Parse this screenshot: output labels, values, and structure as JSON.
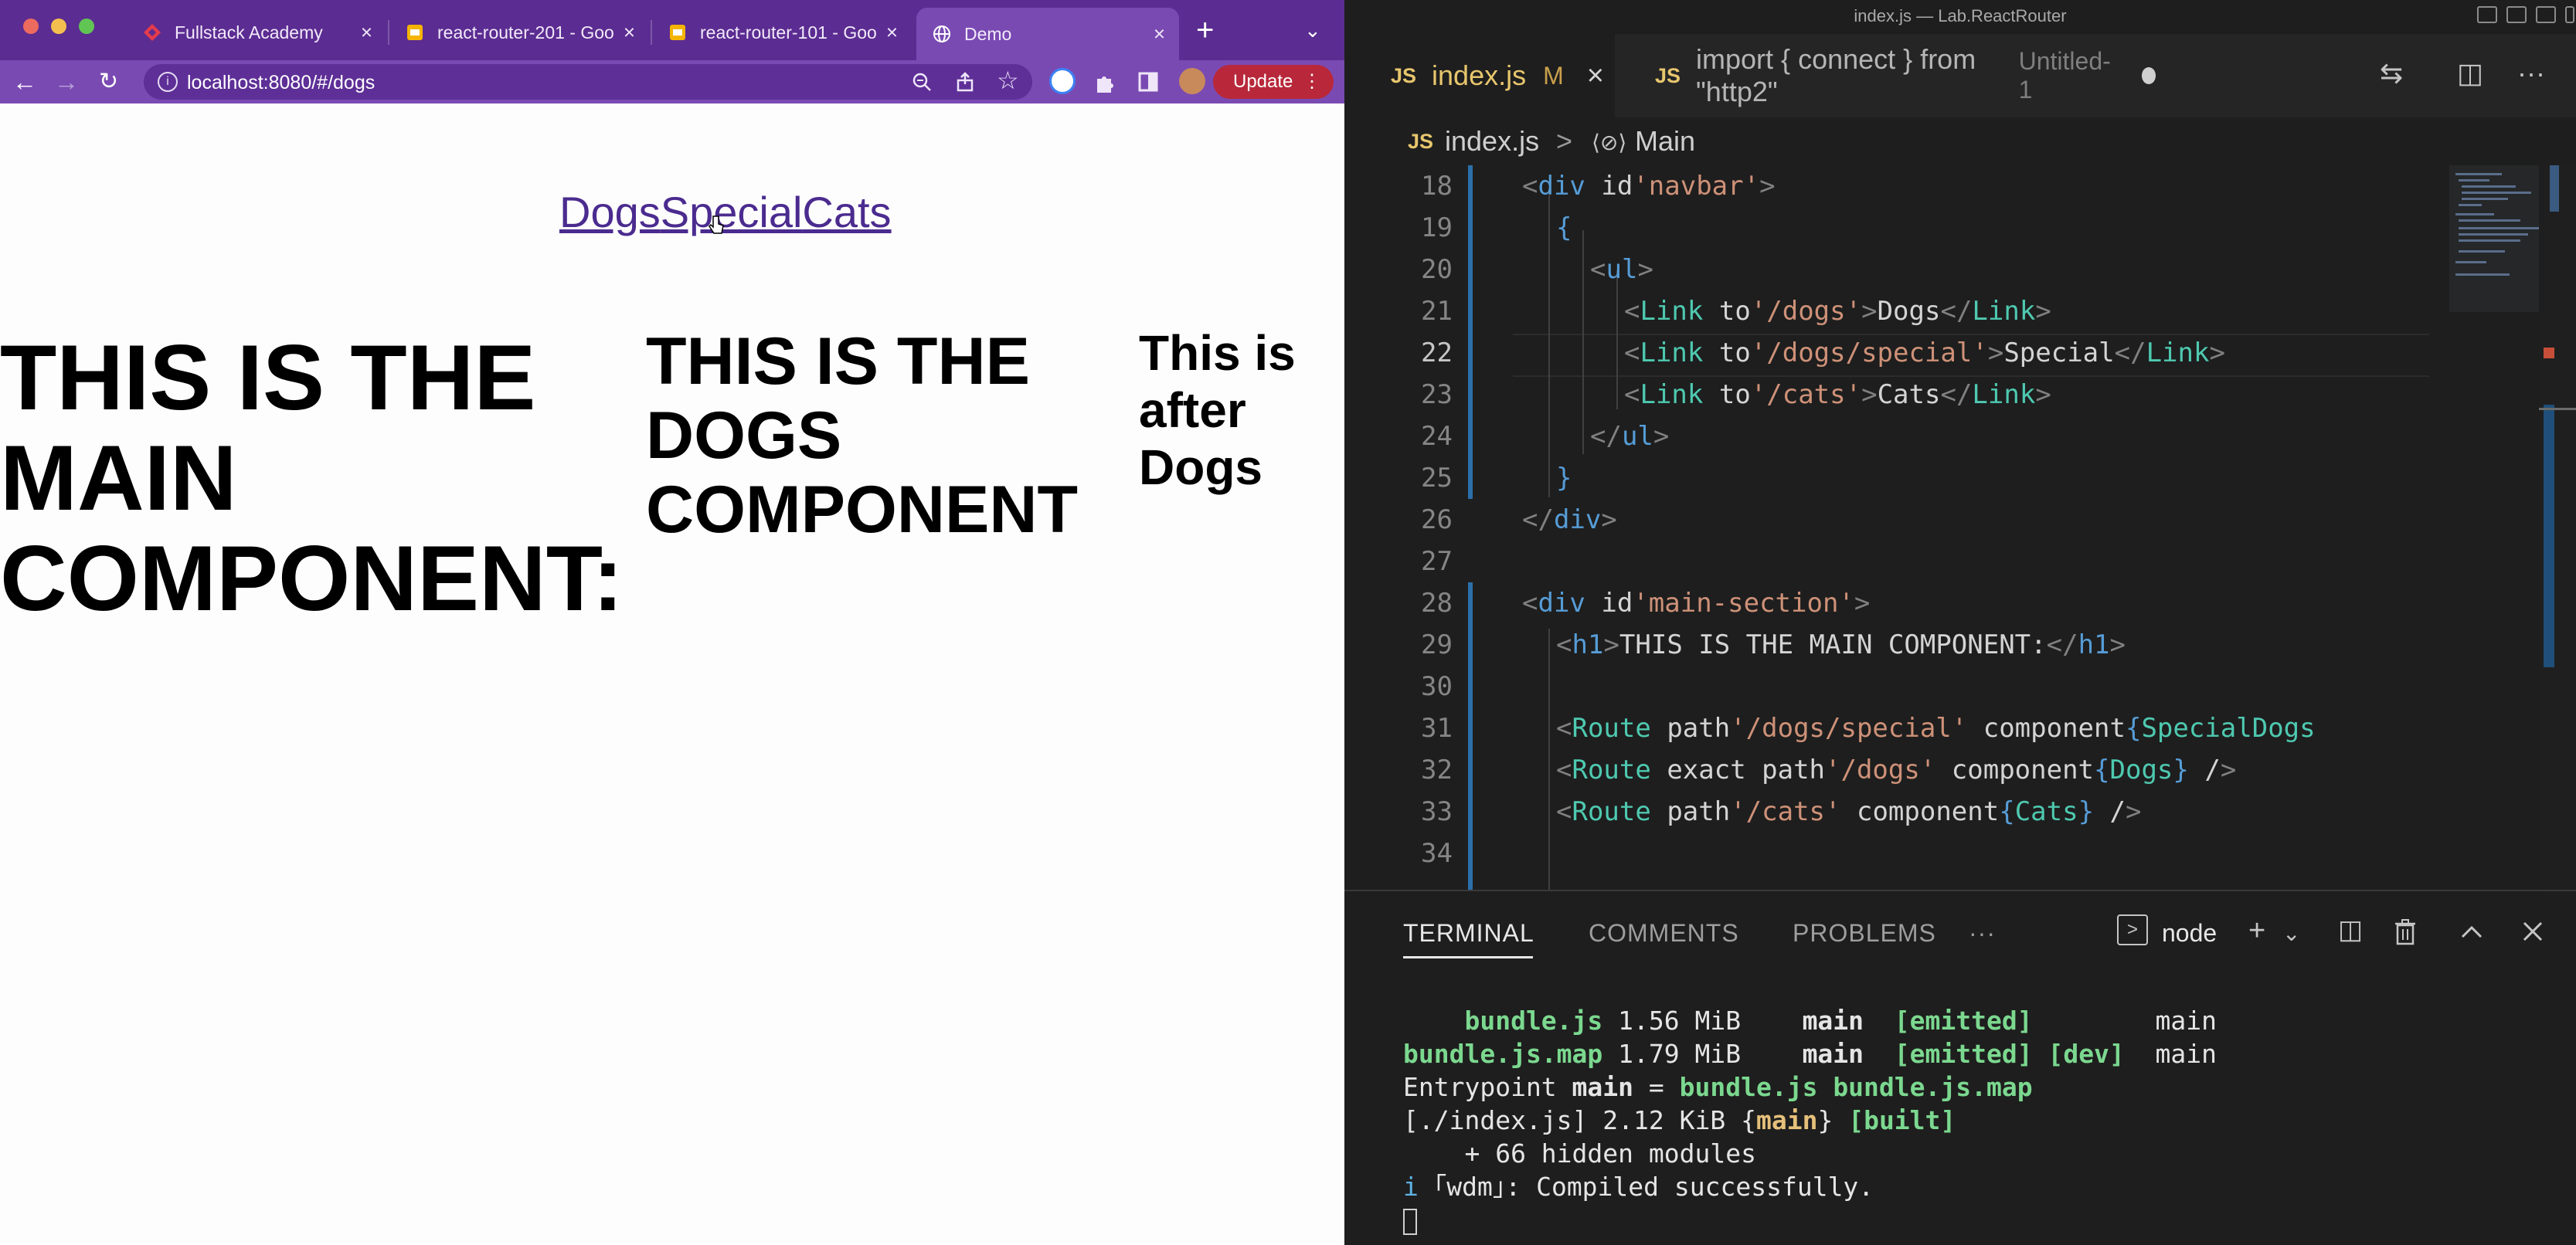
{
  "browser": {
    "tabs": [
      {
        "label": "Fullstack Academy",
        "icon": "fullstack-favicon"
      },
      {
        "label": "react-router-201 - Goo",
        "icon": "google-slides-favicon"
      },
      {
        "label": "react-router-101 - Goo",
        "icon": "google-slides-favicon"
      },
      {
        "label": "Demo",
        "icon": "globe-favicon",
        "active": true
      }
    ],
    "new_tab": "+",
    "url": "localhost:8080/#/dogs",
    "update_label": "Update",
    "update_menu": "⋮",
    "page": {
      "nav_links": [
        "Dogs",
        "Special",
        "Cats"
      ],
      "main_heading": "THIS IS THE MAIN COMPONENT:",
      "dogs_heading": "THIS IS THE DOGS COMPONENT",
      "after_text": "This is after Dogs"
    },
    "colors": {
      "tabbar": "#5b2c91",
      "toolbar": "#7a4ab3",
      "link": "#4b2b8f",
      "update": "#b8283a"
    }
  },
  "editor": {
    "window_title": "index.js — Lab.ReactRouter",
    "tabs": [
      {
        "badge": "JS",
        "label": "index.js",
        "status": "M",
        "active": true
      },
      {
        "badge": "JS",
        "label": "import { connect } from \"http2\"",
        "sub": "Untitled-1",
        "unsaved": true
      }
    ],
    "breadcrumbs": {
      "badge": "JS",
      "file": "index.js",
      "separator": ">",
      "symbol": "Main"
    },
    "current_line": 22,
    "lines": [
      {
        "n": "18",
        "text": "<div id='navbar'>"
      },
      {
        "n": "19",
        "text": "{"
      },
      {
        "n": "20",
        "text": "<ul>"
      },
      {
        "n": "21",
        "text": "<Link to='/dogs'>Dogs</Link>"
      },
      {
        "n": "22",
        "text": "<Link to='/dogs/special'>Special</Link>"
      },
      {
        "n": "23",
        "text": "<Link to='/cats'>Cats</Link>"
      },
      {
        "n": "24",
        "text": "</ul>"
      },
      {
        "n": "25",
        "text": "}"
      },
      {
        "n": "26",
        "text": "</div>"
      },
      {
        "n": "27",
        "text": ""
      },
      {
        "n": "28",
        "text": "<div id='main-section'>"
      },
      {
        "n": "29",
        "text": "<h1>THIS IS THE MAIN COMPONENT:</h1>"
      },
      {
        "n": "30",
        "text": ""
      },
      {
        "n": "31",
        "text": "<Route path='/dogs/special' component={SpecialDogs"
      },
      {
        "n": "32",
        "text": "<Route exact path='/dogs' component={Dogs} />"
      },
      {
        "n": "33",
        "text": "<Route path='/cats' component={Cats} />"
      },
      {
        "n": "34",
        "text": ""
      }
    ],
    "panel": {
      "tabs": [
        "TERMINAL",
        "COMMENTS",
        "PROBLEMS"
      ],
      "more": "···",
      "shell": "node",
      "terminal": [
        {
          "a": "    bundle.js",
          "b": " 1.56 MiB",
          "c": "    main",
          "d": "  [emitted]",
          "e": "        main"
        },
        {
          "a": "bundle.js.map",
          "b": " 1.79 MiB",
          "c": "    main",
          "d": "  [emitted] [dev]",
          "e": "  main"
        },
        {
          "l1": "Entrypoint ",
          "l2": "main",
          "l3": " = ",
          "l4": "bundle.js bundle.js.map"
        },
        {
          "l1": "[./index.js] 2.12 KiB {",
          "l2": "main",
          "l3": "} ",
          "l4": "[built]"
        },
        {
          "l1": "    + 66 hidden modules"
        },
        {
          "l1": "i",
          "l2": " ｢wdm｣: Compiled successfully."
        }
      ]
    }
  }
}
